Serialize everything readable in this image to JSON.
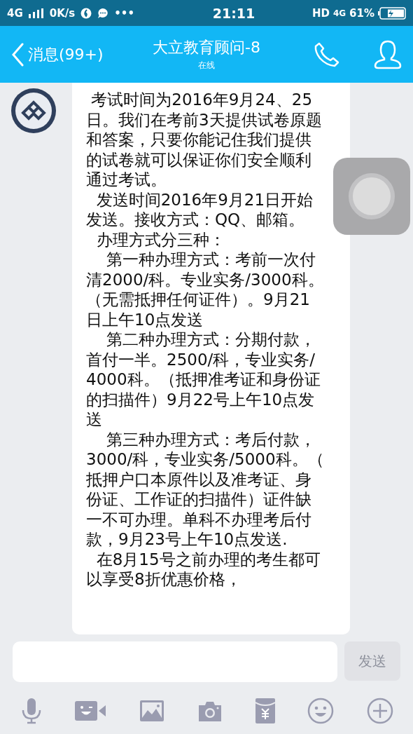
{
  "status_bar": {
    "network": "4G",
    "speed": "0K/s",
    "more": "•••",
    "time": "21:11",
    "hd": "HD",
    "network_right": "4G",
    "battery": "61%"
  },
  "header": {
    "back_label": "消息(99+)",
    "title": "大立教育顾问-8",
    "subtitle": "在线"
  },
  "message": {
    "paragraphs": [
      " 考试时间为2016年9月24、25日。我们在考前3天提供试卷原题和答案，只要你能记住我们提供的试卷就可以保证你们安全顺利通过考试。",
      "  发送时间2016年9月21日开始发送。接收方式：QQ、邮箱。",
      "  办理方式分三种：",
      "    第一种办理方式：考前一次付清2000/科。专业实务/3000科。（无需抵押任何证件）。9月21日上午10点发送",
      "    第二种办理方式：分期付款，首付一半。2500/科，专业实务/4000科。（抵押准考证和身份证的扫描件）9月22号上午10点发送",
      "    第三种办理方式：考后付款，3000/科，专业实务/5000科。（抵押户口本原件以及准考证、身份证、工作证的扫描件）证件缺一不可办理。单科不办理考后付款，9月23号上午10点发送.",
      "  在8月15号之前办理的考生都可以享受8折优惠价格，"
    ]
  },
  "composer": {
    "send_label": "发送",
    "send_disabled": true
  }
}
